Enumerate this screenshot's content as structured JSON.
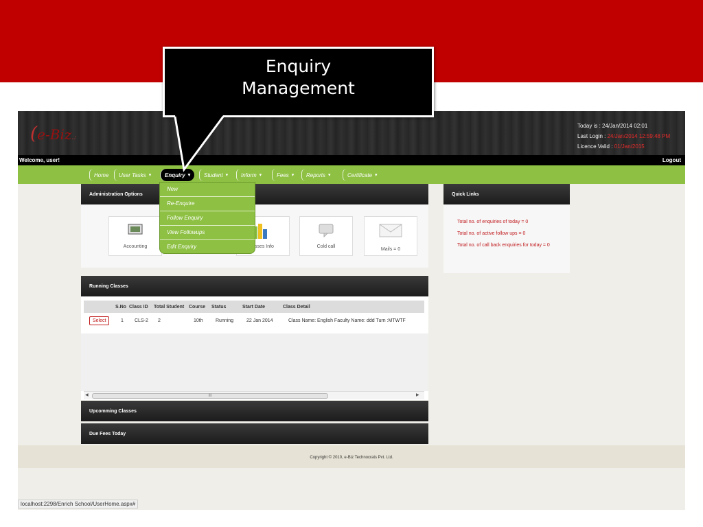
{
  "callout": {
    "line1": "Enquiry",
    "line2": "Management"
  },
  "header": {
    "logo": "e-Biz",
    "today_label": "Today is : ",
    "today_value": "24/Jan/2014 02:01",
    "last_login_label": "Last Login : ",
    "last_login_value": "24/Jan/2014 12:59:48 PM",
    "licence_label": "Licence Valid : ",
    "licence_value": "01/Jan/2015"
  },
  "welcome": "Welcome,  user!",
  "logout": "Logout",
  "nav": {
    "home": "Home",
    "user_tasks": "User Tasks",
    "enquiry": "Enquiry",
    "student": "Student",
    "inform": "Inform",
    "fees": "Fees",
    "reports": "Reports",
    "certificate": "Certificate"
  },
  "enquiry_menu": {
    "new": "New",
    "re_enquire": "Re-Enquire",
    "follow_enquiry": "Follow Enquiry",
    "view_followups": "View Followups",
    "edit_enquiry": "Edit Enquiry"
  },
  "admin": {
    "title": "Administration Options",
    "accounting": "Accounting",
    "classes_info": "asses Info",
    "cold_call": "Cold call",
    "mails": "Mails = 0"
  },
  "quick_links": {
    "title": "Quick Links",
    "enquiries_today": "Total no. of enquiries of today = 0",
    "active_follow_ups": "Total no. of active follow ups = 0",
    "call_back_today": "Total no. of call back enquiries for today = 0"
  },
  "running_classes": {
    "title": "Running Classes",
    "headers": {
      "sno": "S.No",
      "class_id": "Class ID",
      "total_student": "Total Student",
      "course": "Course",
      "status": "Status",
      "start_date": "Start Date",
      "class_detail": "Class Detail"
    },
    "row": {
      "select": "Select",
      "sno": "1",
      "class_id": "CLS-2",
      "total_student": "2",
      "course": "10th",
      "status": "Running",
      "start_date": "22 Jan 2014",
      "class_detail": "Class Name: English Faculty Name: ddd Turn :MTWTF"
    },
    "scroll_grip": "III"
  },
  "upcoming_classes": "Upcomming Classes",
  "due_fees_today": "Due Fees Today",
  "footer": "Copyright © 2010, e-Biz Technocrats Pvt. Ltd.",
  "status_url": "localhost:2298/Enrich School/UserHome.aspx#",
  "colors": {
    "band": "#c00000",
    "nav": "#8dc043",
    "link_red": "#c0181c",
    "header_dark": "#2a2a2a"
  }
}
